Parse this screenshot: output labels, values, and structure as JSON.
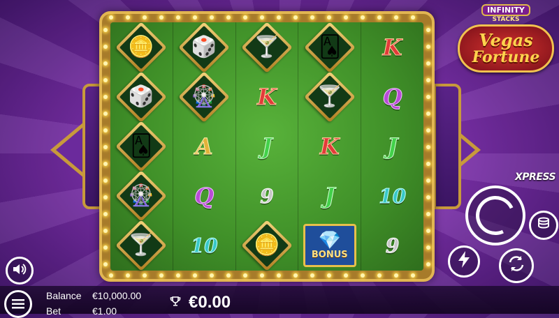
{
  "logo": {
    "line1": "INFINITY",
    "line2": "STACKS",
    "line3": "Vegas",
    "line4": "Fortune"
  },
  "reels": [
    [
      {
        "type": "icon",
        "icon": "coin-stack-icon",
        "glyph": "🪙"
      },
      {
        "type": "icon",
        "icon": "dice-icon",
        "glyph": "🎲"
      },
      {
        "type": "icon",
        "icon": "cards-icon",
        "glyph": "🂡"
      },
      {
        "type": "icon",
        "icon": "roulette-icon",
        "glyph": "🎡"
      },
      {
        "type": "icon",
        "icon": "cocktail-icon",
        "glyph": "🍸"
      }
    ],
    [
      {
        "type": "icon",
        "icon": "dice-icon",
        "glyph": "🎲"
      },
      {
        "type": "icon",
        "icon": "roulette-icon",
        "glyph": "🎡"
      },
      {
        "type": "letter",
        "text": "A",
        "cls": "a"
      },
      {
        "type": "letter",
        "text": "Q",
        "cls": "q"
      },
      {
        "type": "letter",
        "text": "10",
        "cls": "n10"
      }
    ],
    [
      {
        "type": "icon",
        "icon": "cocktail-icon",
        "glyph": "🍸"
      },
      {
        "type": "letter",
        "text": "K",
        "cls": "k"
      },
      {
        "type": "letter",
        "text": "J",
        "cls": "j"
      },
      {
        "type": "letter",
        "text": "9",
        "cls": "n9"
      },
      {
        "type": "icon",
        "icon": "coin-stack-icon",
        "glyph": "🪙"
      }
    ],
    [
      {
        "type": "icon",
        "icon": "cards-icon",
        "glyph": "🂡"
      },
      {
        "type": "icon",
        "icon": "cocktail-icon",
        "glyph": "🍸"
      },
      {
        "type": "letter",
        "text": "K",
        "cls": "k"
      },
      {
        "type": "letter",
        "text": "J",
        "cls": "j"
      },
      {
        "type": "bonus",
        "text": "BONUS",
        "glyph": "💎"
      }
    ],
    [
      {
        "type": "letter",
        "text": "K",
        "cls": "k"
      },
      {
        "type": "letter",
        "text": "Q",
        "cls": "q"
      },
      {
        "type": "letter",
        "text": "J",
        "cls": "j"
      },
      {
        "type": "letter",
        "text": "10",
        "cls": "n10"
      },
      {
        "type": "letter",
        "text": "9",
        "cls": "n9"
      }
    ]
  ],
  "controls": {
    "xpress_label": "XPRESS",
    "stake_icon": "coins-icon",
    "turbo_icon": "lightning-icon",
    "auto_icon": "autoplay-icon",
    "sound_icon": "speaker-icon",
    "menu_icon": "menu-icon"
  },
  "footer": {
    "balance_label": "Balance",
    "balance_value": "€10,000.00",
    "bet_label": "Bet",
    "bet_value": "€1.00",
    "win_value": "€0.00"
  }
}
